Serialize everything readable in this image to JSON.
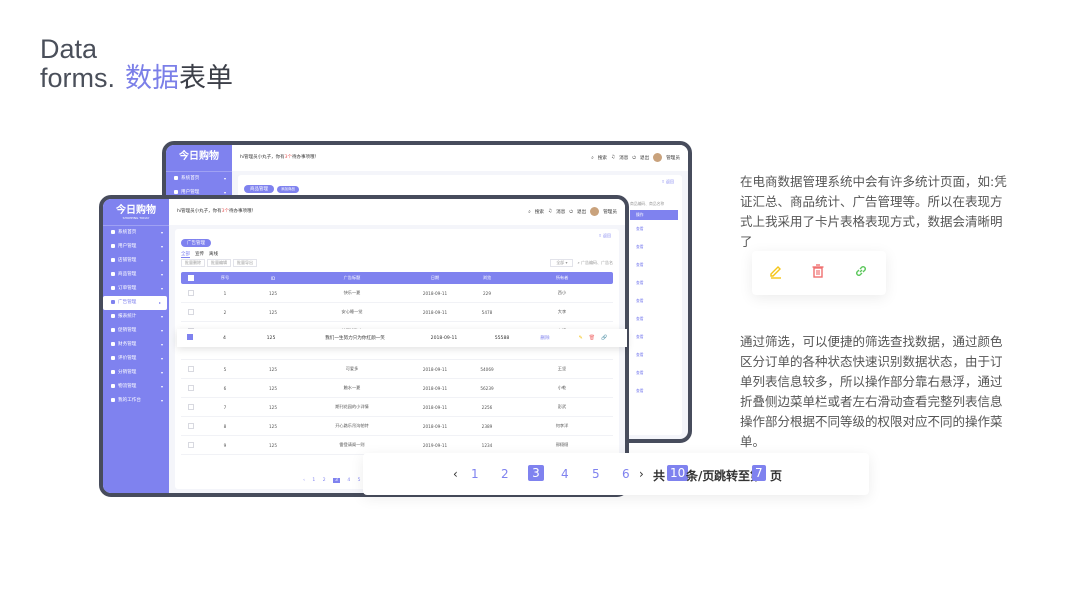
{
  "heading": {
    "line1": "Data",
    "line2": "forms.",
    "accent": "数据",
    "dark": "表单"
  },
  "app": {
    "logo": "今日购物",
    "logo_sub": "SHOPPING TODAY",
    "notice_pre": "hi管理员小丸子，你有",
    "notice_num": "3个",
    "notice_post": "待办事项哦！",
    "search": "搜索",
    "messages": "消息",
    "logout": "退出",
    "admin": "管理员",
    "share": "返回",
    "back_chip": "商品管理",
    "back_chip_extra": "添加商品",
    "front_chip": "广告管理",
    "tabs": [
      "全部",
      "宣传",
      "离线"
    ],
    "tools": [
      "批量删除",
      "批量编辑",
      "批量导出"
    ],
    "select": "全部",
    "search_placeholder": "广告编码、广告名",
    "back_search_placeholder": "商品编码、商品名称",
    "back_col": "操作",
    "back_actions": [
      "查看",
      "查看",
      "查看",
      "查看",
      "查看",
      "查看",
      "查看",
      "查看",
      "查看",
      "查看"
    ],
    "back_num": "25"
  },
  "sidebar_front": [
    {
      "label": "系统首页",
      "active": false
    },
    {
      "label": "用户管理",
      "active": false
    },
    {
      "label": "店铺管理",
      "active": false
    },
    {
      "label": "商品管理",
      "active": false
    },
    {
      "label": "订单管理",
      "active": false
    },
    {
      "label": "广告管理",
      "active": true
    },
    {
      "label": "报表统计",
      "active": false
    },
    {
      "label": "促销管理",
      "active": false
    },
    {
      "label": "财务管理",
      "active": false
    },
    {
      "label": "评价管理",
      "active": false
    },
    {
      "label": "分销管理",
      "active": false
    },
    {
      "label": "物流管理",
      "active": false
    },
    {
      "label": "我的工作台",
      "active": false
    }
  ],
  "sidebar_back": [
    {
      "label": "系统首页"
    },
    {
      "label": "用户管理"
    }
  ],
  "table": {
    "headers": [
      "",
      "序号",
      "ID",
      "广告标题",
      "日期",
      "浏览",
      "所有者"
    ],
    "rows": [
      [
        "1",
        "125",
        "快乐一夏",
        "2018-09-11",
        "229",
        "西小"
      ],
      [
        "2",
        "125",
        "安心睡一觉",
        "2018-09-11",
        "5478",
        "大李"
      ],
      [
        "3",
        "125",
        "美丽找防水",
        "2018-09-11",
        "5869",
        "李婕"
      ],
      [
        "5",
        "125",
        "可爱多",
        "2018-09-11",
        "54069",
        "王坚"
      ],
      [
        "6",
        "125",
        "触水一夏",
        "2018-09-11",
        "56239",
        "小乾"
      ],
      [
        "7",
        "125",
        "期刊花园的小详情",
        "2018-09-11",
        "2256",
        "彭武"
      ],
      [
        "8",
        "125",
        "开心路乐吊沟帕特",
        "2018-09-11",
        "2389",
        "何李洋"
      ],
      [
        "9",
        "125",
        "雷登请阁一则",
        "2019-09-11",
        "1234",
        "邢栩栩"
      ]
    ],
    "highlight": [
      "4",
      "125",
      "我们一生努力只为你红颜一笑",
      "2018-09-11",
      "55588",
      "删除"
    ]
  },
  "mini_pager": {
    "pages": [
      "1",
      "2",
      "3",
      "4",
      "5",
      "6"
    ],
    "current": "3",
    "total_pre": "共",
    "total": "10",
    "total_post": "条/页",
    "jump_pre": "跳转至第",
    "jump": "7",
    "jump_post": "页"
  },
  "pager": {
    "prev": "‹",
    "next": "›",
    "pages": [
      "1",
      "2",
      "3",
      "4",
      "5",
      "6"
    ],
    "current_index": 2,
    "total_pre": "共",
    "total": "10",
    "total_post": "条/页",
    "jump_pre": "跳转至第",
    "jump": "7",
    "jump_post": "页"
  },
  "icons": {
    "edit": "edit-icon",
    "delete": "delete-icon",
    "link": "link-icon"
  },
  "colors": {
    "accent": "#7f82ef",
    "edit": "#f5c518",
    "delete": "#f07070",
    "link": "#5cc75c"
  },
  "desc1": "在电商数据管理系统中会有许多统计页面，如:凭证汇总、商品统计、广告管理等。所以在表现方式上我采用了卡片表格表现方式，数据会清晰明了",
  "desc2": "通过筛选，可以便捷的筛选查找数据，通过颜色区分订单的各种状态快速识别数据状态，由于订单列表信息较多，所以操作部分靠右悬浮，通过折叠侧边菜单栏或者左右滑动查看完整列表信息操作部分根据不同等级的权限对应不同的操作菜单。"
}
